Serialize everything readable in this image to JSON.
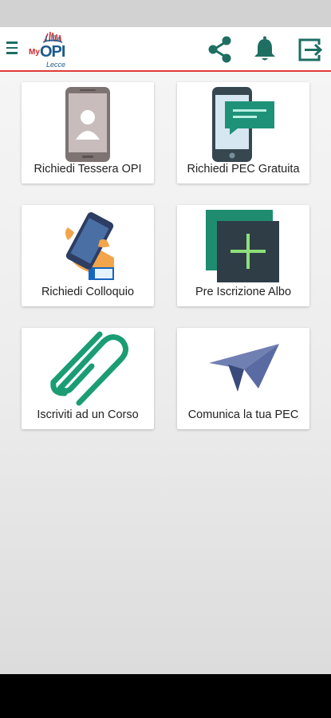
{
  "app": {
    "logo": {
      "prefix": "My",
      "name": "OPI",
      "city": "Lecce"
    },
    "accent_color": "#e23a3a",
    "icon_color": "#1e6e62",
    "icons": [
      "menu-icon",
      "share-icon",
      "bell-icon",
      "exit-icon"
    ]
  },
  "tiles": [
    {
      "label": "Richiedi Tessera OPI",
      "icon": "id-card-phone-icon"
    },
    {
      "label": "Richiedi PEC Gratuita",
      "icon": "phone-chat-icon"
    },
    {
      "label": "Richiedi Colloquio",
      "icon": "hand-phone-icon"
    },
    {
      "label": "Pre Iscrizione Albo",
      "icon": "add-square-icon"
    },
    {
      "label": "Iscriviti ad un Corso",
      "icon": "paperclip-icon"
    },
    {
      "label": "Comunica la tua PEC",
      "icon": "paper-plane-icon"
    }
  ]
}
